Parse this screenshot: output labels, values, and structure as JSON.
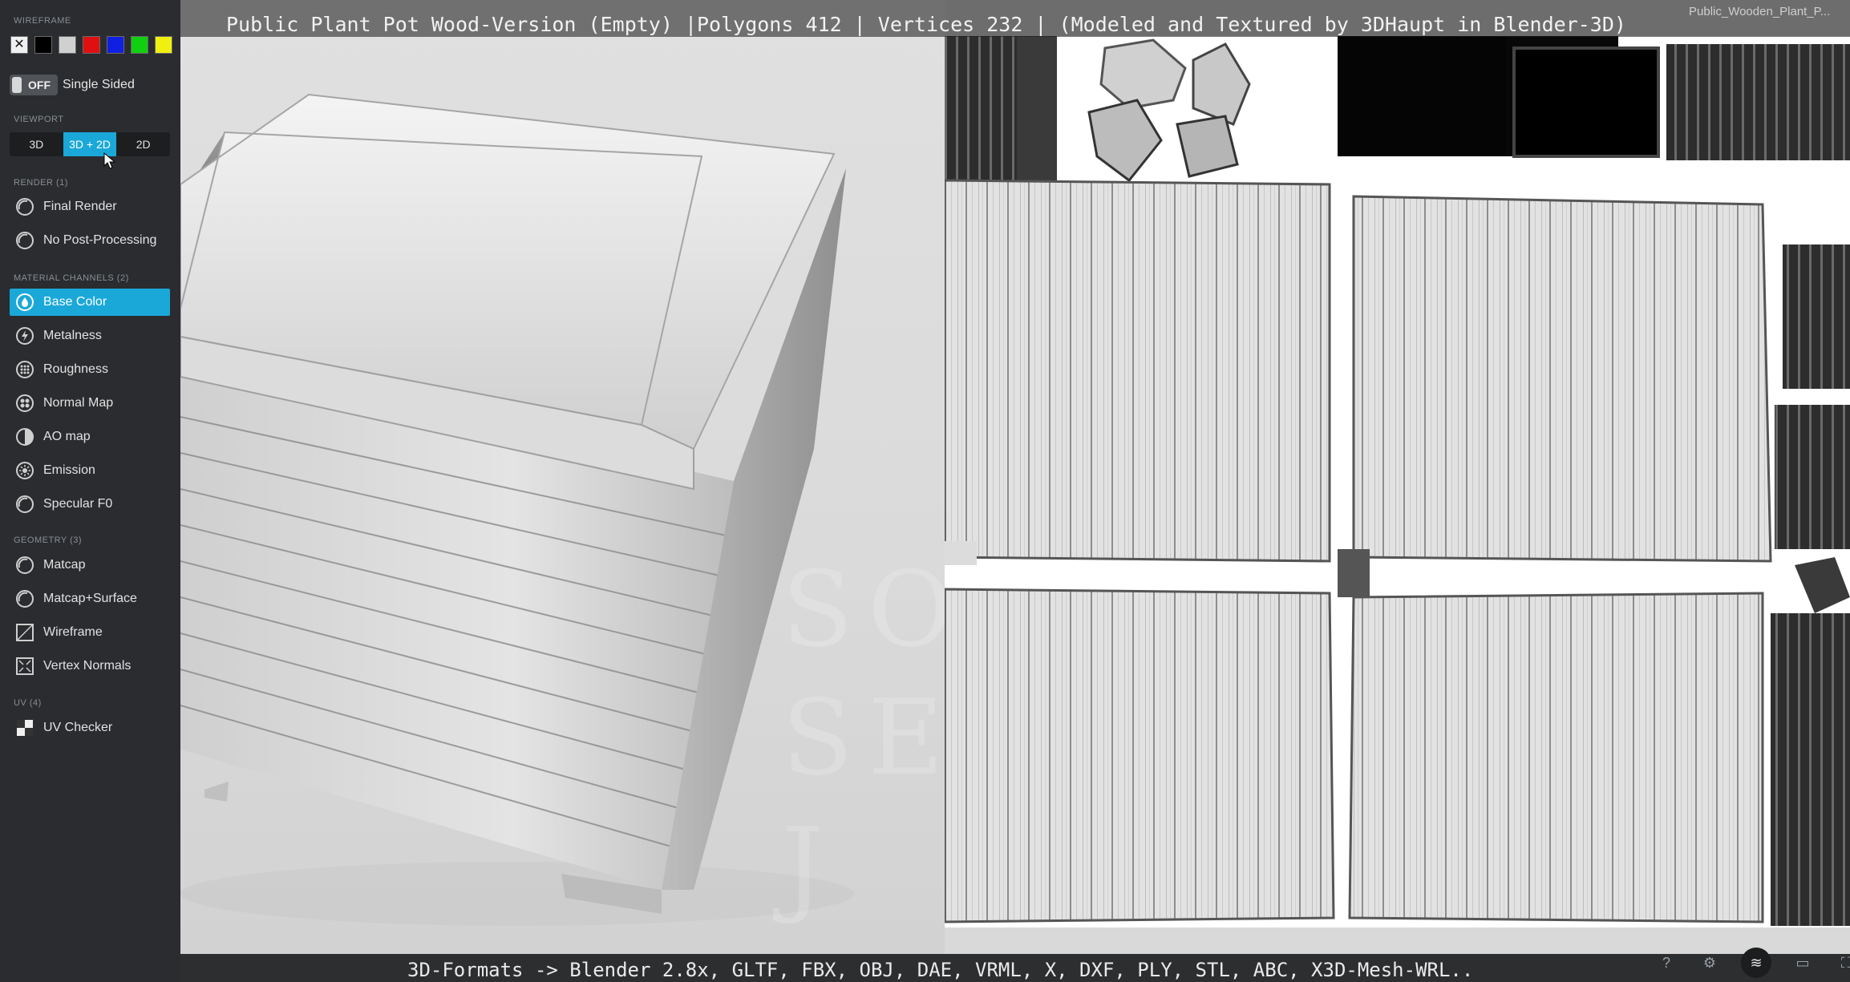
{
  "title_overlay": "Public Plant Pot Wood-Version (Empty) |Polygons 412 | Vertices 232 | (Modeled and Textured by 3DHaupt in Blender-3D)",
  "file_label": "Public_Wooden_Plant_P...",
  "bottom_overlay": "3D-Formats -> Blender 2.8x, GLTF, FBX, OBJ, DAE, VRML, X, DXF, PLY, STL, ABC, X3D-Mesh-WRL..",
  "watermark": "SO\nSE\nJ",
  "colors": {
    "accent": "#1aa8d8",
    "sidebar_bg": "#2a2c2f"
  },
  "sidebar": {
    "wireframe_label": "WIREFRAME",
    "swatches": [
      "#f0f0f0",
      "#000000",
      "#d0d0d0",
      "#e01010",
      "#1020e0",
      "#10d010",
      "#f0f010"
    ],
    "single_sided": {
      "state": "OFF",
      "label": "Single Sided"
    },
    "viewport": {
      "label": "VIEWPORT",
      "options": [
        "3D",
        "3D + 2D",
        "2D"
      ],
      "selected": "3D + 2D"
    },
    "render": {
      "label": "RENDER (1)",
      "items": [
        {
          "label": "Final Render",
          "icon": "sphere-icon"
        },
        {
          "label": "No Post-Processing",
          "icon": "sphere-icon"
        }
      ]
    },
    "material_channels": {
      "label": "MATERIAL CHANNELS (2)",
      "items": [
        {
          "label": "Base Color",
          "icon": "drop-icon",
          "active": true
        },
        {
          "label": "Metalness",
          "icon": "bolt-icon"
        },
        {
          "label": "Roughness",
          "icon": "dots-icon"
        },
        {
          "label": "Normal Map",
          "icon": "normal-map-icon"
        },
        {
          "label": "AO map",
          "icon": "half-circle-icon"
        },
        {
          "label": "Emission",
          "icon": "sun-icon"
        },
        {
          "label": "Specular F0",
          "icon": "sphere-icon"
        }
      ]
    },
    "geometry": {
      "label": "GEOMETRY (3)",
      "items": [
        {
          "label": "Matcap",
          "icon": "sphere-icon"
        },
        {
          "label": "Matcap+Surface",
          "icon": "sphere-icon"
        },
        {
          "label": "Wireframe",
          "icon": "wireframe-icon"
        },
        {
          "label": "Vertex Normals",
          "icon": "vertex-normals-icon"
        }
      ]
    },
    "uv": {
      "label": "UV (4)",
      "items": [
        {
          "label": "UV Checker",
          "icon": "checker-icon"
        }
      ]
    }
  }
}
